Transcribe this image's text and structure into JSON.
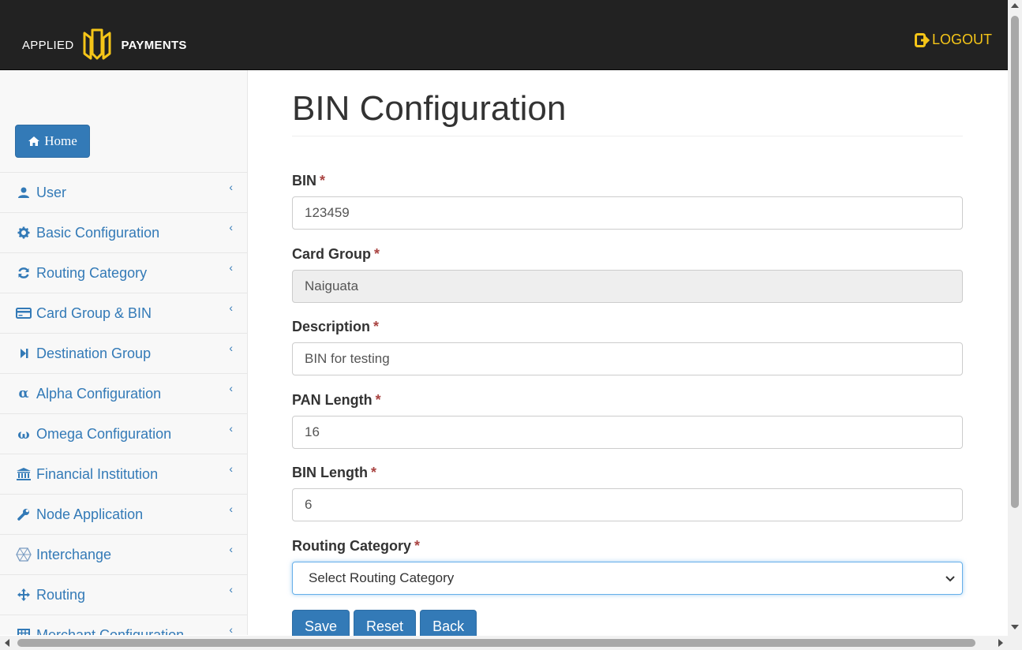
{
  "header": {
    "brand_left": "APPLIED",
    "brand_right": "PAYMENTS",
    "logout_label": "LOGOUT",
    "accent_color": "#f5c518"
  },
  "sidebar": {
    "home_label": "Home",
    "items": [
      {
        "label": "User",
        "icon": "user-icon"
      },
      {
        "label": "Basic Configuration",
        "icon": "gear-icon"
      },
      {
        "label": "Routing Category",
        "icon": "refresh-icon"
      },
      {
        "label": "Card Group & BIN",
        "icon": "credit-card-icon"
      },
      {
        "label": "Destination Group",
        "icon": "step-forward-icon"
      },
      {
        "label": "Alpha Configuration",
        "icon": "alpha-icon"
      },
      {
        "label": "Omega Configuration",
        "icon": "omega-icon"
      },
      {
        "label": "Financial Institution",
        "icon": "bank-icon"
      },
      {
        "label": "Node Application",
        "icon": "wrench-icon"
      },
      {
        "label": "Interchange",
        "icon": "network-icon"
      },
      {
        "label": "Routing",
        "icon": "move-icon"
      },
      {
        "label": "Merchant Configuration",
        "icon": "grid-icon"
      }
    ]
  },
  "main": {
    "title": "BIN Configuration",
    "required_marker": "*",
    "fields": {
      "bin": {
        "label": "BIN",
        "value": "123459"
      },
      "card_group": {
        "label": "Card Group",
        "value": "Naiguata"
      },
      "description": {
        "label": "Description",
        "value": "BIN for testing"
      },
      "pan_length": {
        "label": "PAN Length",
        "value": "16"
      },
      "bin_length": {
        "label": "BIN Length",
        "value": "6"
      },
      "routing_category": {
        "label": "Routing Category",
        "value": "Select Routing Category"
      }
    },
    "buttons": {
      "save": "Save",
      "reset": "Reset",
      "back": "Back"
    }
  },
  "colors": {
    "primary": "#337ab7",
    "navbar": "#222222",
    "required": "#a94442"
  }
}
